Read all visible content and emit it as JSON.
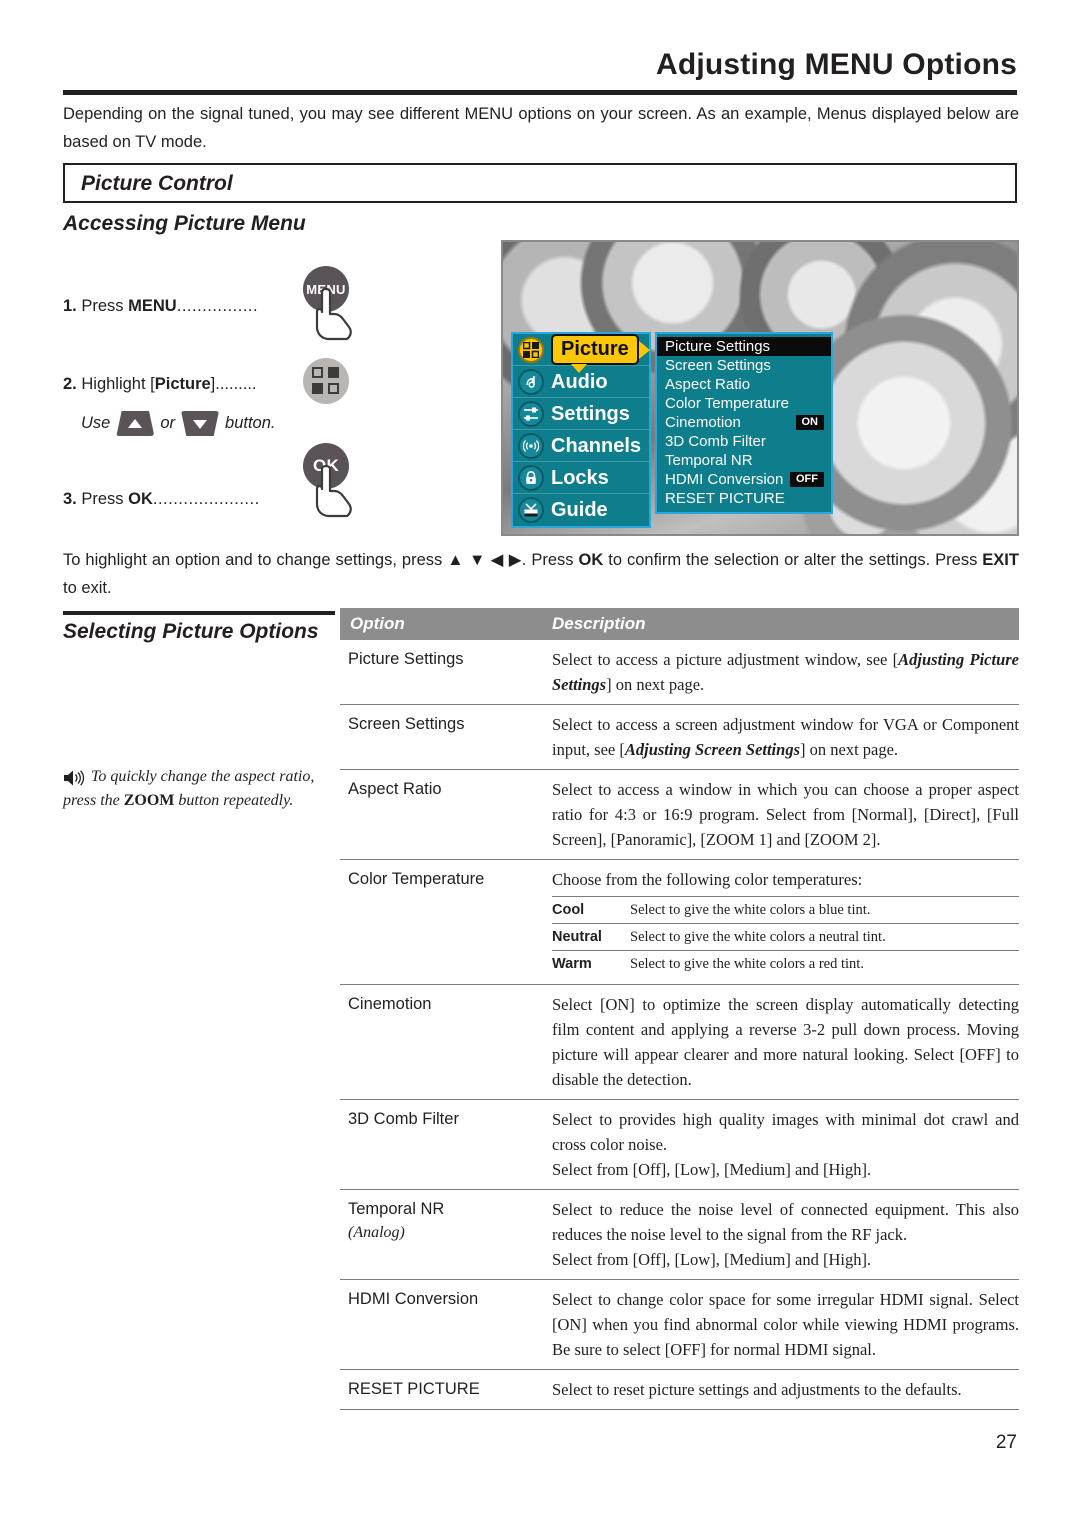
{
  "header": {
    "title": "Adjusting MENU Options",
    "intro": "Depending on the signal tuned, you may see different MENU options on your screen. As an example, Menus displayed below are based on TV mode."
  },
  "section": {
    "picture_control_label": "Picture Control",
    "accessing_heading": "Accessing Picture Menu",
    "selecting_heading": "Selecting Picture Options"
  },
  "steps": {
    "step1_num": "1.",
    "step1_text": "Press",
    "step1_key": "MENU",
    "step1_dots": "................",
    "step2_num": "2.",
    "step2_text": "Highlight [",
    "step2_key": "Picture",
    "step2_tail": "].........",
    "use_prefix": "Use",
    "use_or": "or",
    "use_suffix": "button.",
    "step3_num": "3.",
    "step3_text": "Press",
    "step3_key": "OK",
    "step3_dots": ".....................",
    "menu_button_label": "MENU",
    "ok_button_label": "OK"
  },
  "paragraph2": {
    "part1": "To highlight an option and to change settings, press ",
    "arrows": "▲ ▼ ◀ ▶",
    "part2": ". Press ",
    "ok": "OK",
    "part3": " to confirm the selection or alter the settings. Press ",
    "exit": "EXIT",
    "part4": " to exit."
  },
  "note": {
    "text": "To quickly change the aspect ratio, press the ZOOM button repeatedly.",
    "line1": "To quickly change the aspect ratio,",
    "line2_pre": "press the ",
    "line2_key": "ZOOM",
    "line2_post": " button repeatedly."
  },
  "tv_osd": {
    "sidebar": [
      {
        "label": "Picture",
        "icon": "grid-icon",
        "active": true
      },
      {
        "label": "Audio",
        "icon": "note-icon",
        "active": false
      },
      {
        "label": "Settings",
        "icon": "sliders-icon",
        "active": false
      },
      {
        "label": "Channels",
        "icon": "antenna-icon",
        "active": false
      },
      {
        "label": "Locks",
        "icon": "lock-icon",
        "active": false
      },
      {
        "label": "Guide",
        "icon": "guide-icon",
        "active": false
      }
    ],
    "panel": [
      {
        "label": "Picture Settings",
        "badge": "",
        "selected": true
      },
      {
        "label": "Screen Settings",
        "badge": "",
        "selected": false
      },
      {
        "label": "Aspect Ratio",
        "badge": "",
        "selected": false
      },
      {
        "label": "Color Temperature",
        "badge": "",
        "selected": false
      },
      {
        "label": "Cinemotion",
        "badge": "ON",
        "selected": false
      },
      {
        "label": "3D Comb Filter",
        "badge": "",
        "selected": false
      },
      {
        "label": "Temporal NR",
        "badge": "",
        "selected": false
      },
      {
        "label": "HDMI Conversion",
        "badge": "OFF",
        "selected": false
      },
      {
        "label": "RESET PICTURE",
        "badge": "",
        "selected": false
      }
    ],
    "colors": {
      "teal": "#0E7D8C",
      "gold": "#FBC707",
      "border_blue": "#2AA8DD",
      "selected_black": "#0B0B0B"
    }
  },
  "table": {
    "header": {
      "option": "Option",
      "description": "Description"
    },
    "rows": [
      {
        "option": "Picture Settings",
        "sub": "",
        "desc_pre": "Select to access a picture adjustment window, see [",
        "desc_em": "Adjusting Picture Settings",
        "desc_post": "] on next page."
      },
      {
        "option": "Screen Settings",
        "sub": "",
        "desc_pre": "Select to access a screen adjustment window for VGA or Component input, see [",
        "desc_em": "Adjusting Screen Settings",
        "desc_post": "] on next page."
      },
      {
        "option": "Aspect Ratio",
        "sub": "",
        "desc_pre": "Select to access a window in which you can choose a proper aspect ratio for 4:3 or 16:9 program. Select from [Normal], [Direct], [Full Screen], [Panoramic], [ZOOM 1] and [ZOOM 2].",
        "desc_em": "",
        "desc_post": ""
      },
      {
        "option": "Color Temperature",
        "sub": "",
        "desc_pre": "Choose from the following color temperatures:",
        "desc_em": "",
        "desc_post": "",
        "subtable": [
          {
            "key": "Cool",
            "value": "Select to give the white colors a blue tint."
          },
          {
            "key": "Neutral",
            "value": "Select to give the white colors a neutral tint."
          },
          {
            "key": "Warm",
            "value": "Select to give the white colors a red tint."
          }
        ]
      },
      {
        "option": "Cinemotion",
        "sub": "",
        "desc_pre": "Select [ON] to optimize the screen display automatically detecting film content and applying a reverse 3-2 pull down process. Moving picture will appear clearer and more natural looking. Select [OFF] to disable the detection.",
        "desc_em": "",
        "desc_post": ""
      },
      {
        "option": "3D Comb Filter",
        "sub": "",
        "desc_pre": "Select to provides high quality images with minimal dot crawl and cross color noise.",
        "desc_em": "",
        "desc_post": "",
        "desc_line2": "Select from [Off], [Low], [Medium] and [High]."
      },
      {
        "option": "Temporal NR",
        "sub": "(Analog)",
        "desc_pre": "Select to reduce the noise level of connected equipment. This also reduces the noise level to the signal from the RF jack.",
        "desc_em": "",
        "desc_post": "",
        "desc_line2": "Select from [Off], [Low], [Medium] and [High]."
      },
      {
        "option": "HDMI Conversion",
        "sub": "",
        "desc_pre": "Select to change color space for some irregular HDMI signal. Select [ON] when you find abnormal color while viewing HDMI programs. Be sure to select [OFF] for normal HDMI signal.",
        "desc_em": "",
        "desc_post": ""
      },
      {
        "option": "RESET PICTURE",
        "sub": "",
        "desc_pre": "Select to reset picture settings and adjustments to the defaults.",
        "desc_em": "",
        "desc_post": ""
      }
    ]
  },
  "footer": {
    "page_number": "27"
  }
}
